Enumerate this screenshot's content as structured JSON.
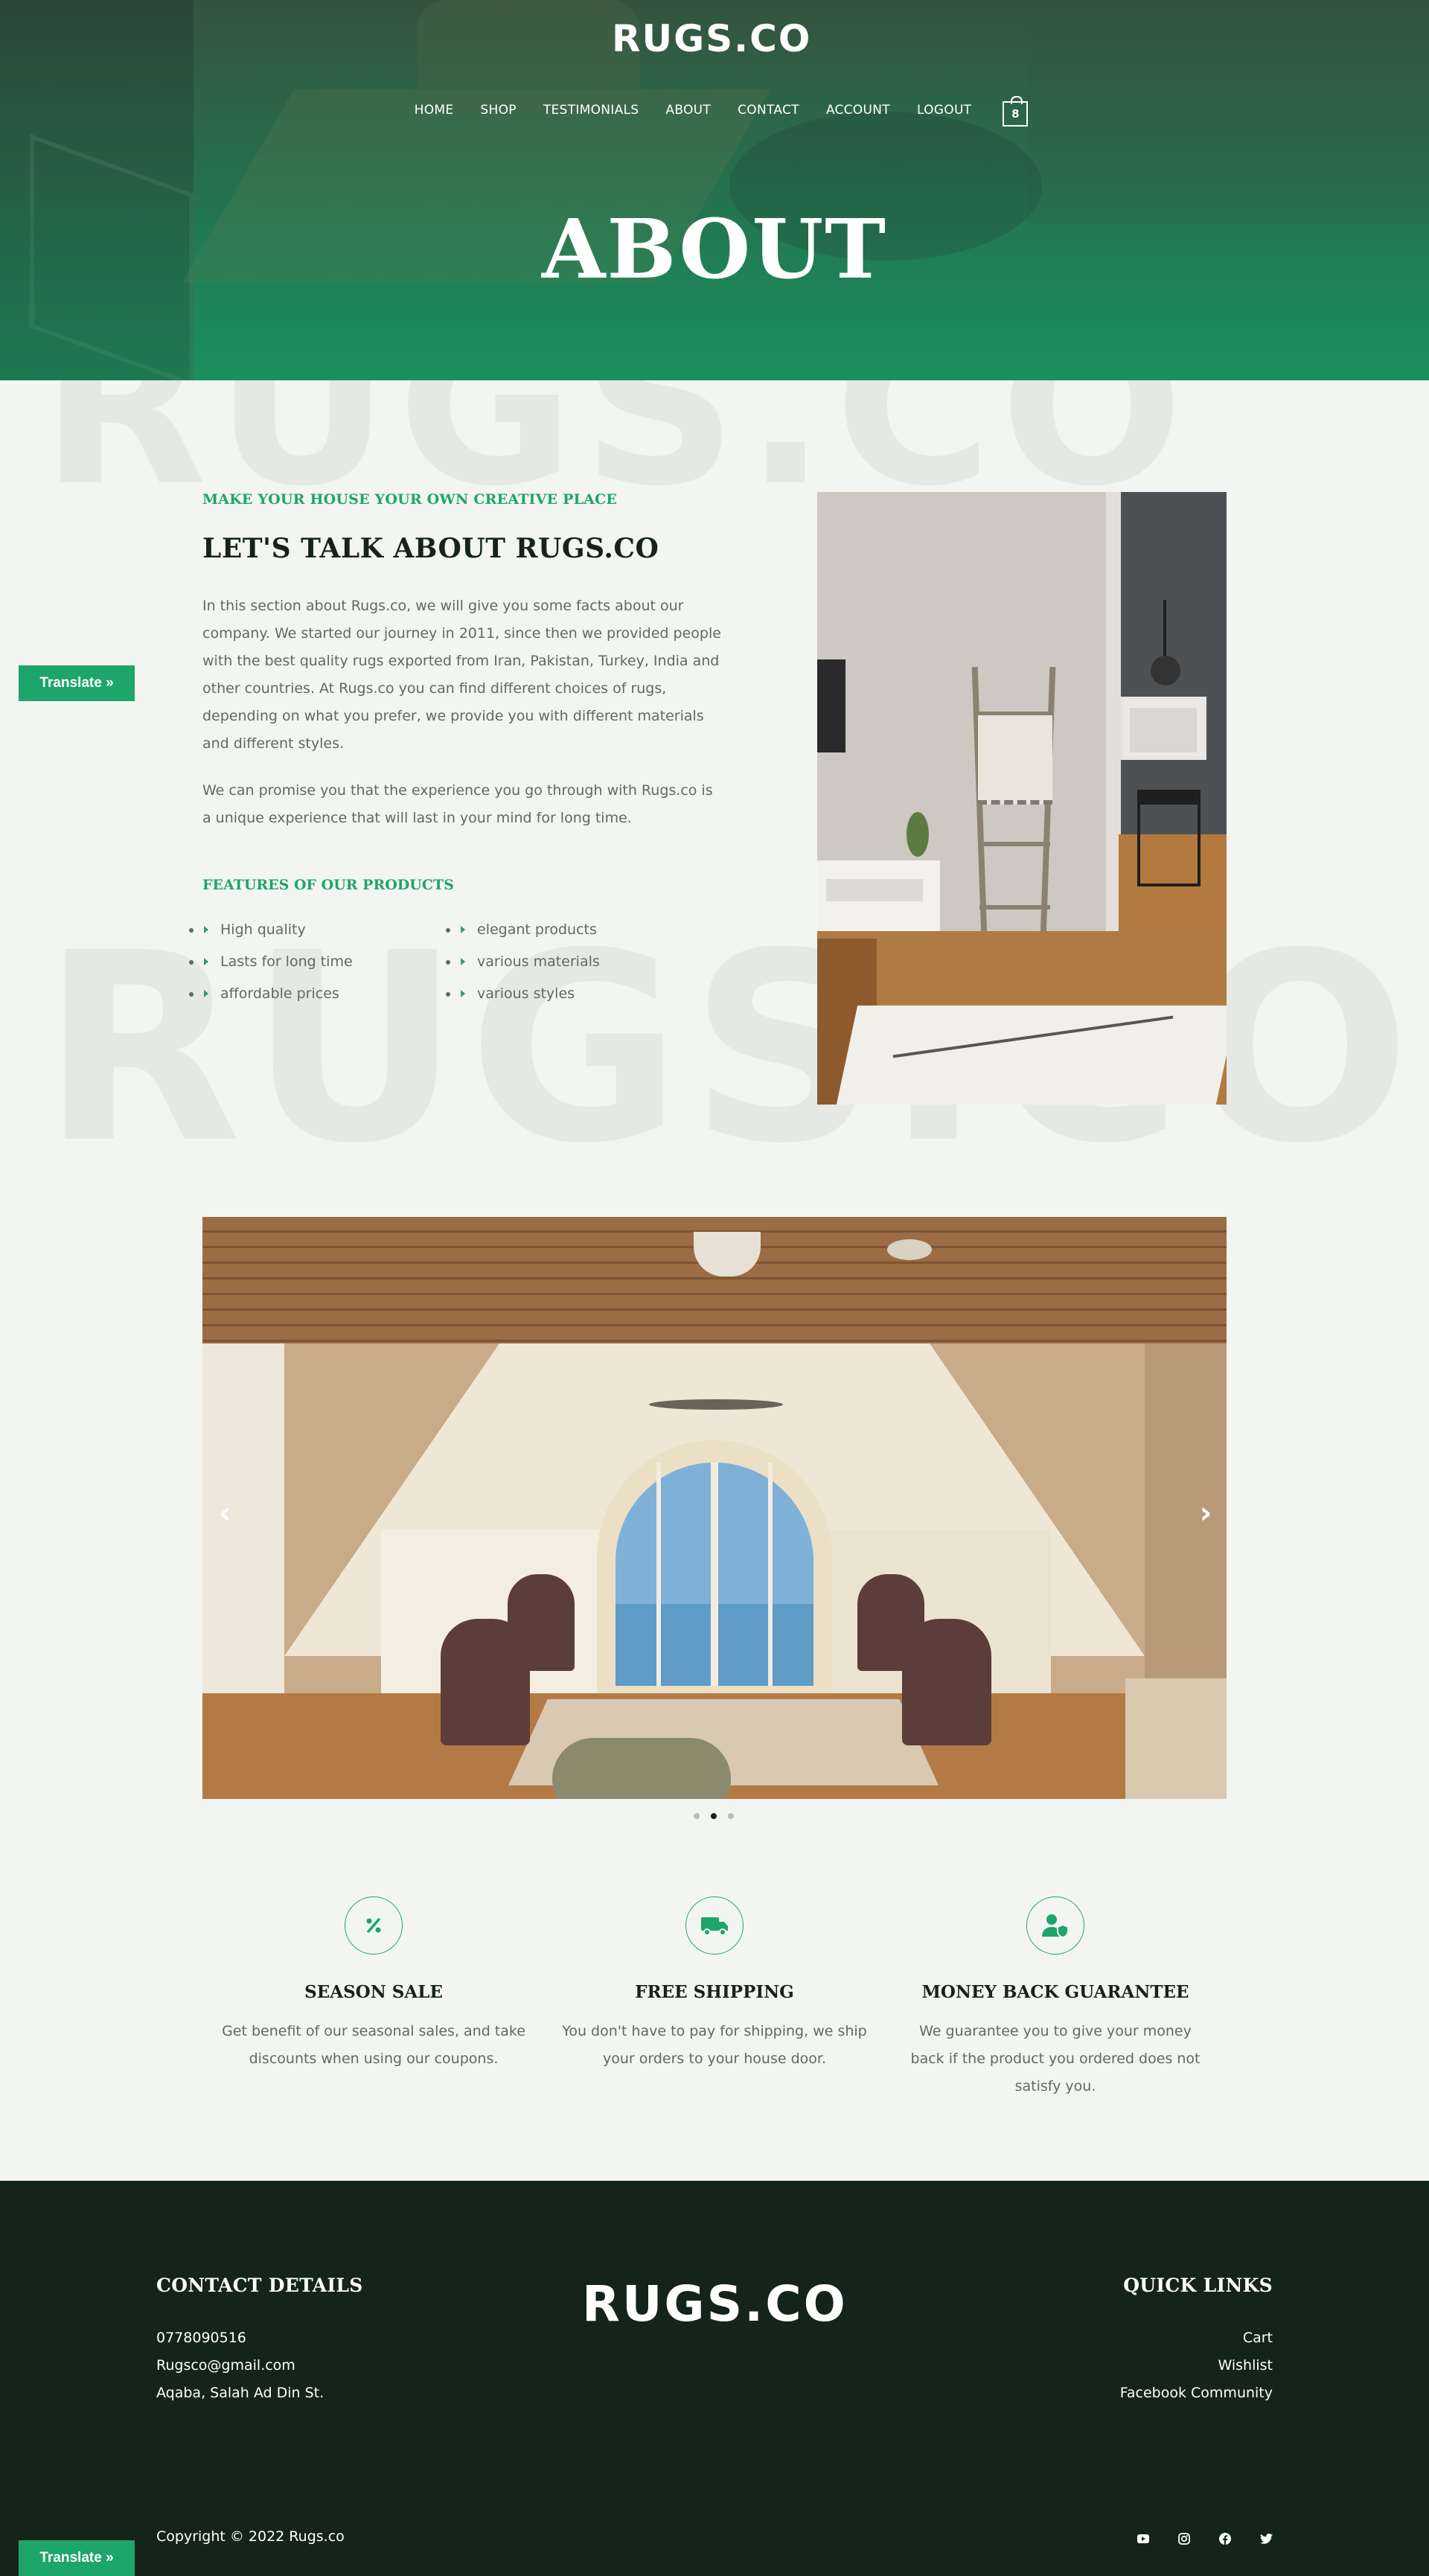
{
  "brand": {
    "logo_text": "RUGS.CO",
    "accent": "#1ea56a",
    "footer_bg": "#14241b"
  },
  "nav": {
    "items": [
      "HOME",
      "SHOP",
      "TESTIMONIALS",
      "ABOUT",
      "CONTACT",
      "ACCOUNT",
      "LOGOUT"
    ],
    "cart_count": "8"
  },
  "hero": {
    "title": "ABOUT"
  },
  "about": {
    "subtitle": "MAKE YOUR HOUSE YOUR OWN CREATIVE PLACE",
    "title": "LET'S TALK ABOUT RUGS.CO",
    "paragraph1": "In this section about Rugs.co, we will give you some facts about our company. We started our journey in 2011, since then we provided people with the best quality rugs exported from Iran, Pakistan, Turkey, India and other countries. At Rugs.co you can find different choices of rugs, depending on what you prefer, we provide you with different materials and different styles.",
    "paragraph2": "We can promise you that the experience you go through with Rugs.co is a unique experience that will last in your mind for long time.",
    "features_title": "FEATURES OF OUR PRODUCTS",
    "features": [
      "High quality",
      "elegant products",
      "Lasts for long time",
      "various materials",
      "affordable prices",
      "various styles"
    ]
  },
  "carousel": {
    "slide_count": 3,
    "active_index": 1,
    "prev_icon": "chevron-left-icon",
    "next_icon": "chevron-right-icon"
  },
  "services": [
    {
      "icon": "percent-icon",
      "title": "SEASON SALE",
      "text": "Get benefit of our seasonal sales, and take discounts when using our coupons."
    },
    {
      "icon": "delivery-truck-icon",
      "title": "FREE SHIPPING",
      "text": "You don't have to pay for shipping, we ship your orders to your house door."
    },
    {
      "icon": "user-shield-icon",
      "title": "MONEY BACK GUARANTEE",
      "text": "We guarantee you to give your money back if the product you ordered does not satisfy you."
    }
  ],
  "footer": {
    "contact_title": "CONTACT DETAILS",
    "phone": "0778090516",
    "email": "Rugsco@gmail.com",
    "address": "Aqaba, Salah Ad Din St.",
    "links_title": "QUICK LINKS",
    "links": [
      "Cart",
      "Wishlist",
      "Facebook Community"
    ],
    "copyright": "Copyright © 2022 Rugs.co",
    "socials": [
      "youtube-icon",
      "instagram-icon",
      "facebook-icon",
      "twitter-icon"
    ]
  },
  "translate_label": "Translate »"
}
